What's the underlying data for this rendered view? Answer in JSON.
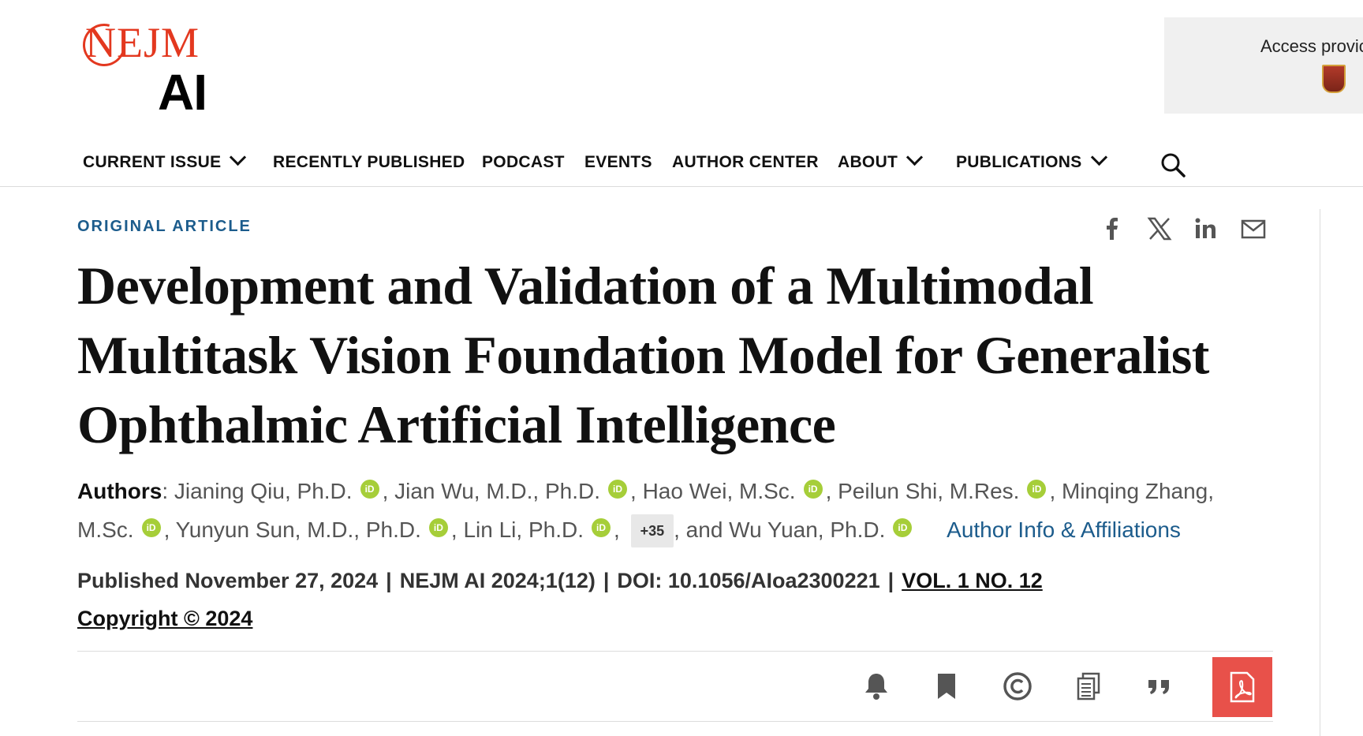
{
  "brand": {
    "logo_top": "NEJM",
    "logo_bottom": "AI"
  },
  "access": {
    "text": "Access provic"
  },
  "nav": {
    "current_issue": "CURRENT ISSUE",
    "recently_published": "RECENTLY PUBLISHED",
    "podcast": "PODCAST",
    "events": "EVENTS",
    "author_center": "AUTHOR CENTER",
    "about": "ABOUT",
    "publications": "PUBLICATIONS"
  },
  "article": {
    "kicker": "ORIGINAL ARTICLE",
    "title": "Development and Validation of a Multimodal Multitask Vision Foundation Model for Generalist Ophthalmic Artificial Intelligence",
    "authors_label": "Authors",
    "authors": [
      "Jianing Qiu, Ph.D.",
      "Jian Wu, M.D., Ph.D.",
      "Hao Wei, M.Sc.",
      "Peilun Shi, M.Res.",
      "Minqing Zhang, M.Sc.",
      "Yunyun Sun, M.D., Ph.D.",
      "Lin Li, Ph.D."
    ],
    "more_authors": "+35",
    "last_author": "and Wu Yuan, Ph.D.",
    "affiliations_link": "Author Info & Affiliations",
    "orcid_label": "iD",
    "published": "Published November 27, 2024",
    "citation": "NEJM AI 2024;1(12)",
    "doi": "DOI: 10.1056/AIoa2300221",
    "volume": "VOL. 1 NO. 12",
    "copyright": "Copyright © 2024",
    "separator": "|"
  },
  "colors": {
    "brand_red": "#e3381f",
    "link_blue": "#1c5c8c",
    "pdf_red": "#e8514a",
    "orcid_green": "#a6ce39"
  },
  "icons": {
    "share": [
      "facebook-icon",
      "x-icon",
      "linkedin-icon",
      "email-icon"
    ],
    "tools": [
      "bell-icon",
      "bookmark-icon",
      "copyright-icon",
      "copy-icon",
      "quote-icon",
      "pdf-icon"
    ]
  }
}
